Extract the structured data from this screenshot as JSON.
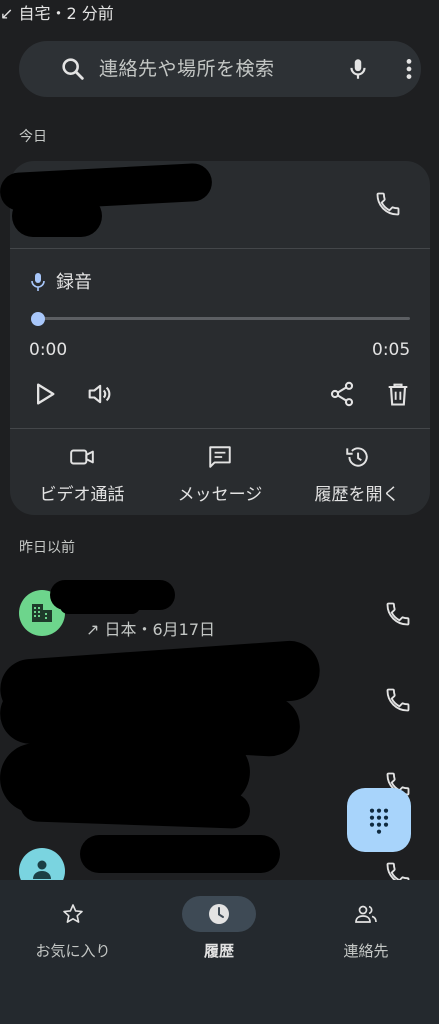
{
  "search": {
    "placeholder": "連絡先や場所を検索"
  },
  "sections": {
    "today": "今日",
    "earlier": "昨日以前"
  },
  "expanded_call": {
    "meta": "↙ 自宅・2 分前",
    "recording": {
      "label": "録音",
      "elapsed": "0:00",
      "duration": "0:05",
      "progress": 0.0
    },
    "actions": [
      {
        "label": "ビデオ通話",
        "icon": "video-icon"
      },
      {
        "label": "メッセージ",
        "icon": "message-icon"
      },
      {
        "label": "履歴を開く",
        "icon": "history-icon"
      }
    ]
  },
  "calls": [
    {
      "meta": "↗ 日本・6月17日",
      "avatar": "business-icon",
      "avatar_color": "#6dd58c"
    }
  ],
  "bottom_nav": {
    "items": [
      {
        "label": "お気に入り",
        "icon": "star-icon",
        "active": false
      },
      {
        "label": "履歴",
        "icon": "clock-icon",
        "active": true
      },
      {
        "label": "連絡先",
        "icon": "contacts-icon",
        "active": false
      }
    ]
  },
  "colors": {
    "background": "#1e1f21",
    "accent": "#a8c7fa",
    "fab": "#a8d4fb"
  }
}
